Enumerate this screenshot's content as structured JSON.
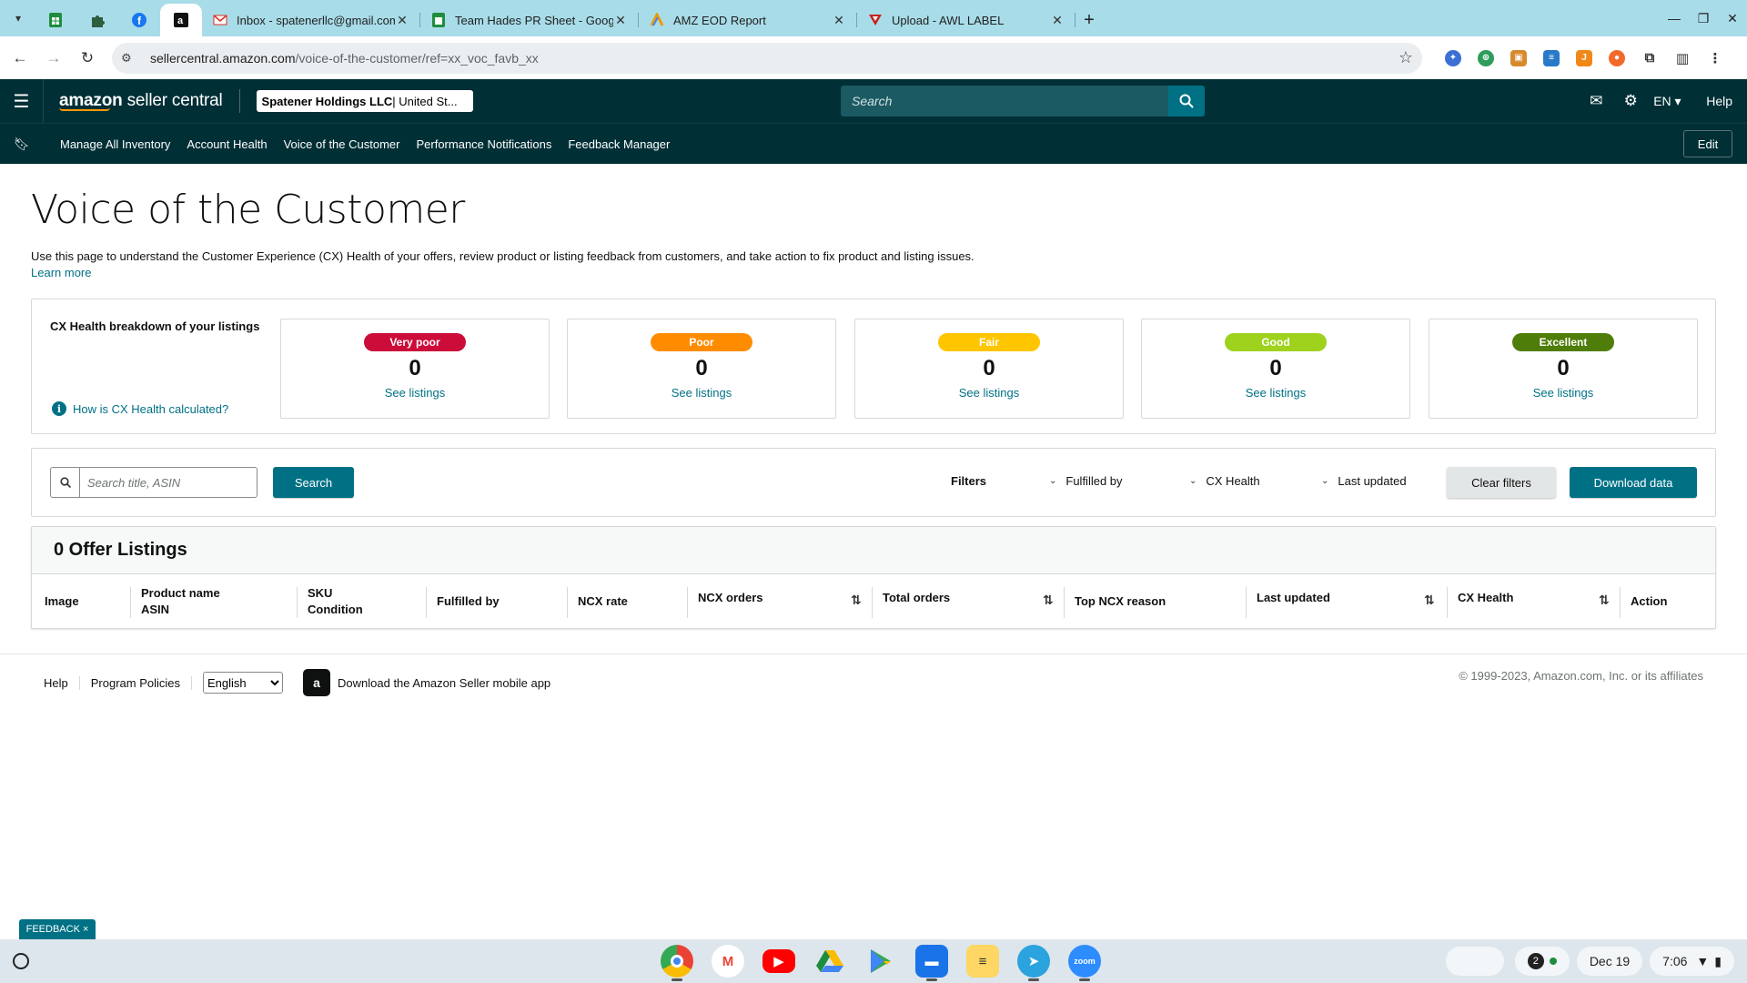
{
  "browser": {
    "tabs": [
      {
        "title": "Inbox - spatenerllc@gmail.com",
        "favicon": "gmail-icon"
      },
      {
        "title": "Team Hades PR Sheet - Google",
        "favicon": "sheets-icon"
      },
      {
        "title": "AMZ EOD Report",
        "favicon": "report-icon"
      },
      {
        "title": "Upload - AWL LABEL",
        "favicon": "upload-icon"
      }
    ],
    "url_host": "sellercentral.amazon.com",
    "url_path": "/voice-of-the-customer/ref=xx_voc_favb_xx"
  },
  "header": {
    "logo_bold": "amazon",
    "logo_rest": " seller central",
    "account_name": "Spatener Holdings LLC",
    "account_region": " | United St...",
    "search_placeholder": "Search",
    "language": "EN ▾",
    "help": "Help"
  },
  "bookmarks": {
    "items": [
      "Manage All Inventory",
      "Account Health",
      "Voice of the Customer",
      "Performance Notifications",
      "Feedback Manager"
    ],
    "edit_label": "Edit"
  },
  "page": {
    "title": "Voice of the Customer",
    "intro": "Use this page to understand the Customer Experience (CX) Health of your offers, review product or listing feedback from customers, and take action to fix product and listing issues.",
    "learn_more": "Learn more"
  },
  "cx_health": {
    "heading": "CX Health breakdown of your listings",
    "how_link": "How is CX Health calculated?",
    "cards": [
      {
        "label": "Very poor",
        "count": "0",
        "link": "See listings",
        "color": "#cc0c39"
      },
      {
        "label": "Poor",
        "count": "0",
        "link": "See listings",
        "color": "#ff8c00"
      },
      {
        "label": "Fair",
        "count": "0",
        "link": "See listings",
        "color": "#ffc600"
      },
      {
        "label": "Good",
        "count": "0",
        "link": "See listings",
        "color": "#9ed21d"
      },
      {
        "label": "Excellent",
        "count": "0",
        "link": "See listings",
        "color": "#4f7d09"
      }
    ]
  },
  "filters": {
    "search_placeholder": "Search title, ASIN",
    "search_button": "Search",
    "label": "Filters",
    "fulfilled_by": "Fulfilled by",
    "cx_health": "CX Health",
    "last_updated": "Last updated",
    "clear": "Clear filters",
    "download": "Download data"
  },
  "listings": {
    "heading": "0 Offer Listings",
    "columns": {
      "image": "Image",
      "product_name": "Product name",
      "asin": "ASIN",
      "sku": "SKU",
      "condition": "Condition",
      "fulfilled_by": "Fulfilled by",
      "ncx_rate": "NCX rate",
      "ncx_orders": "NCX orders",
      "total_orders": "Total orders",
      "top_ncx_reason": "Top NCX reason",
      "last_updated": "Last updated",
      "cx_health": "CX Health",
      "action": "Action"
    }
  },
  "footer": {
    "help": "Help",
    "policies": "Program Policies",
    "language_selected": "English",
    "app_link": "Download the Amazon Seller mobile app",
    "copyright": "© 1999-2023, Amazon.com, Inc. or its affiliates"
  },
  "feedback_tab": "FEEDBACK ×",
  "taskbar": {
    "notification_count": "2",
    "date": "Dec 19",
    "time": "7:06"
  }
}
